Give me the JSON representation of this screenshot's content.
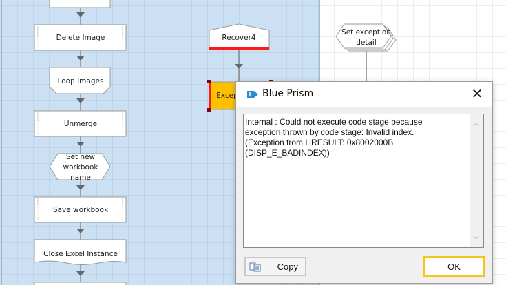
{
  "flow": {
    "stages": {
      "delete_image": "Delete Image",
      "loop_images": "Loop Images",
      "unmerge": "Unmerge",
      "set_new_workbook_name": [
        "Set new",
        "workbook",
        "name"
      ],
      "save_workbook": "Save workbook",
      "close_excel": "Close Excel Instance",
      "recover": "Recover4",
      "exception": "Excep",
      "set_exception_detail": [
        "Set exception",
        "detail"
      ]
    }
  },
  "dialog": {
    "title": "Blue Prism",
    "message": "Internal : Could not execute code stage because\nexception thrown by code stage: Invalid index.\n(Exception from HRESULT: 0x8002000B\n(DISP_E_BADINDEX))",
    "copy_label": "Copy",
    "ok_label": "OK",
    "close_symbol": "✕"
  },
  "colors": {
    "canvas_blue": "#cce0f4",
    "accent_yellow": "#ffc000",
    "error_red": "#ff1a1a",
    "ok_border": "#f5c518"
  }
}
